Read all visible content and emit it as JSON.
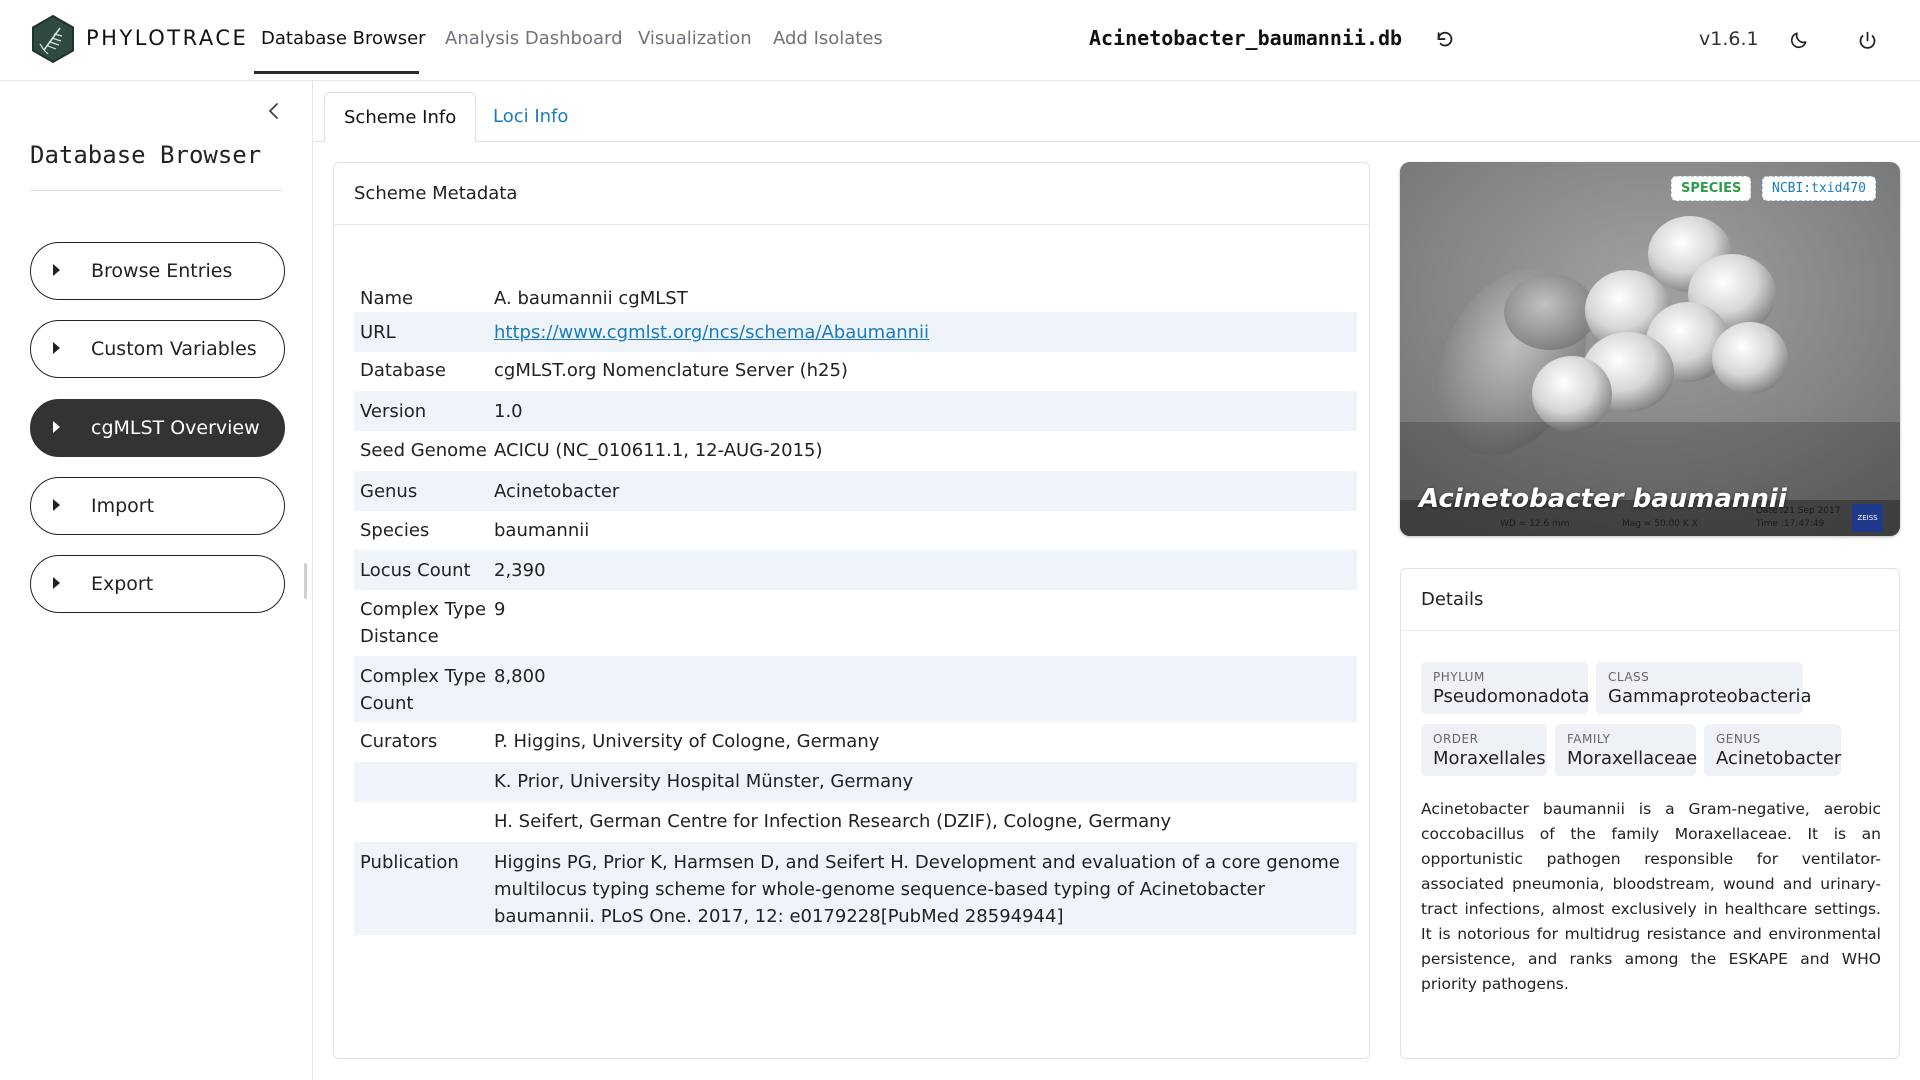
{
  "app": {
    "brand": "PHYLOTRACE",
    "db_name": "Acinetobacter_baumannii.db",
    "version": "v1.6.1"
  },
  "nav": {
    "items": [
      {
        "label": "Database Browser",
        "active": true
      },
      {
        "label": "Analysis Dashboard",
        "active": false
      },
      {
        "label": "Visualization",
        "active": false
      },
      {
        "label": "Add Isolates",
        "active": false
      }
    ]
  },
  "icons": {
    "logo": "phylotrace-logo-icon",
    "reload": "reload-icon",
    "theme": "moon-icon",
    "power": "power-icon",
    "collapse": "chevron-left-icon",
    "caret": "caret-right-icon"
  },
  "sidebar": {
    "title": "Database Browser",
    "items": [
      {
        "label": "Browse Entries",
        "active": false
      },
      {
        "label": "Custom Variables",
        "active": false
      },
      {
        "label": "cgMLST Overview",
        "active": true
      },
      {
        "label": "Import",
        "active": false
      },
      {
        "label": "Export",
        "active": false
      }
    ]
  },
  "tabs": [
    {
      "label": "Scheme Info",
      "active": true
    },
    {
      "label": "Loci Info",
      "active": false
    }
  ],
  "metadata": {
    "title": "Scheme Metadata",
    "rows": [
      {
        "key": "Name",
        "value": "A. baumannii cgMLST"
      },
      {
        "key": "URL",
        "value": "https://www.cgmlst.org/ncs/schema/Abaumannii"
      },
      {
        "key": "Database",
        "value": "cgMLST.org Nomenclature Server (h25)"
      },
      {
        "key": "Version",
        "value": "1.0"
      },
      {
        "key": "Seed Genome",
        "value": "ACICU (NC_010611.1, 12-AUG-2015)"
      },
      {
        "key": "Genus",
        "value": "Acinetobacter"
      },
      {
        "key": "Species",
        "value": "baumannii"
      },
      {
        "key": "Locus Count",
        "value": "2,390"
      },
      {
        "key": "Complex Type Distance",
        "value": "9"
      },
      {
        "key": "Complex Type Count",
        "value": "8,800"
      },
      {
        "key": "Curators",
        "value": "P. Higgins, University of Cologne, Germany"
      },
      {
        "key": "",
        "value": "K. Prior, University Hospital Münster, Germany"
      },
      {
        "key": "",
        "value": "H. Seifert, German Centre for Infection Research (DZIF), Cologne, Germany"
      },
      {
        "key": "Publication",
        "value": "Higgins PG, Prior K, Harmsen D, and Seifert H. Development and evaluation of a core genome multilocus typing scheme for whole-genome sequence-based typing of Acinetobacter baumannii. PLoS One. 2017, 12: e0179228[PubMed 28594944]"
      }
    ]
  },
  "image_card": {
    "badge_species": "SPECIES",
    "badge_ncbi": "NCBI:txid470",
    "caption": "Acinetobacter baumannii",
    "sem_wd": "WD = 12.6 mm",
    "sem_mag": "Mag = 50.00 K X",
    "sem_date": "Date :21 Sep 2017",
    "sem_time": "Time :17:47:49",
    "sem_logo": "ZEISS"
  },
  "details": {
    "title": "Details",
    "taxonomy": [
      {
        "label": "PHYLUM",
        "value": "Pseudomonadota"
      },
      {
        "label": "CLASS",
        "value": "Gammaproteobacteria"
      },
      {
        "label": "ORDER",
        "value": "Moraxellales"
      },
      {
        "label": "FAMILY",
        "value": "Moraxellaceae"
      },
      {
        "label": "GENUS",
        "value": "Acinetobacter"
      }
    ],
    "description": "Acinetobacter baumannii is a Gram-negative, aerobic coccobacillus of the family Moraxellaceae. It is an opportunistic pathogen responsible for ventilator-associated pneumonia, bloodstream, wound and urinary-tract infections, almost exclusively in healthcare settings. It is notorious for multidrug resistance and environmental persistence, and ranks among the ESKAPE and WHO priority pathogens."
  }
}
